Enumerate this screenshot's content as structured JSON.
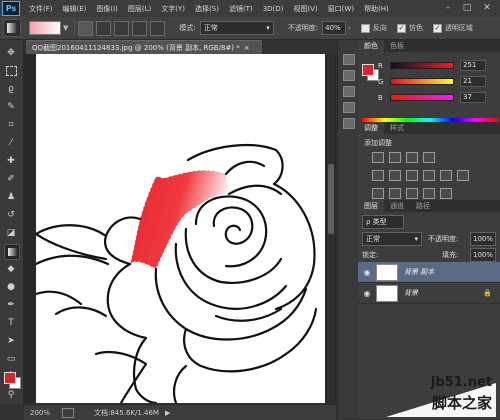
{
  "app": {
    "logo": "Ps"
  },
  "menu": [
    "文件(F)",
    "编辑(E)",
    "图像(I)",
    "图层(L)",
    "文字(Y)",
    "选择(S)",
    "滤镜(T)",
    "3D(D)",
    "视图(V)",
    "窗口(W)",
    "帮助(H)"
  ],
  "window_controls": [
    "–",
    "□",
    "✕"
  ],
  "options": {
    "mode_label": "模式:",
    "mode_value": "正常",
    "opacity_label": "不透明度:",
    "opacity_value": "40%",
    "reverse_label": "反向",
    "dither_label": "仿色",
    "transparency_label": "透明区域"
  },
  "document": {
    "tab_title": "QQ截图20160411124833.jpg @ 200% (背景 副本, RGB/8#) *",
    "close_glyph": "×"
  },
  "status": {
    "zoom": "200%",
    "doc_info": "文档:845.6K/1.46M",
    "arrow": "▶"
  },
  "color_panel": {
    "tabs": [
      "颜色",
      "色板"
    ],
    "channels": [
      {
        "label": "R",
        "value": "251"
      },
      {
        "label": "G",
        "value": "21"
      },
      {
        "label": "B",
        "value": "37"
      }
    ]
  },
  "adjustments_panel": {
    "tabs": [
      "调整",
      "样式"
    ],
    "add_label": "添加调整"
  },
  "layers_panel": {
    "tabs": [
      "图层",
      "通道",
      "路径"
    ],
    "kind_label": "ρ 类型",
    "blend_mode": "正常",
    "opacity_label": "不透明度:",
    "opacity_value": "100%",
    "lock_label": "锁定:",
    "fill_label": "填充:",
    "fill_value": "100%",
    "layers": [
      {
        "name": "背景 副本"
      },
      {
        "name": "背景"
      }
    ]
  },
  "watermark": {
    "url": "jb51.net",
    "text": "脚本之家"
  },
  "colors": {
    "foreground": "#e0202a",
    "background": "#ffffff",
    "selection_fill": "#e8232b"
  }
}
